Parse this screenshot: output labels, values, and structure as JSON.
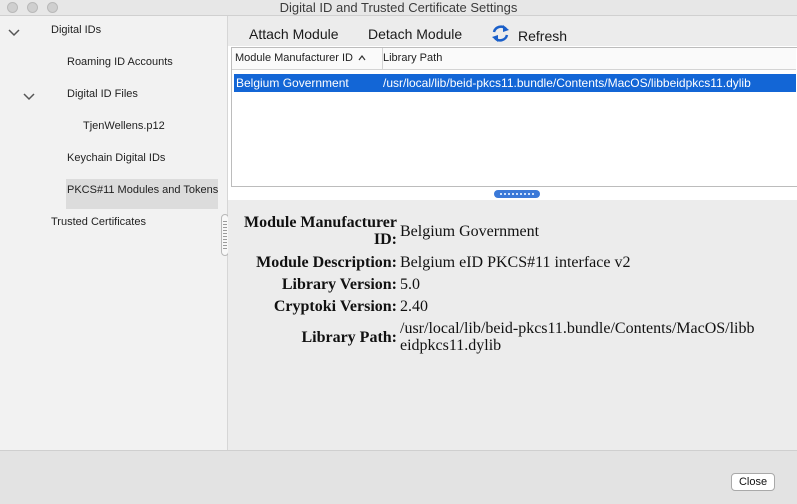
{
  "window": {
    "title": "Digital ID and Trusted Certificate Settings"
  },
  "sidebar": {
    "items": [
      {
        "label": "Digital IDs"
      },
      {
        "label": "Roaming ID Accounts"
      },
      {
        "label": "Digital ID Files"
      },
      {
        "label": "TjenWellens.p12"
      },
      {
        "label": "Keychain Digital IDs"
      },
      {
        "label": "PKCS#11 Modules and Tokens"
      },
      {
        "label": "Trusted Certificates"
      }
    ]
  },
  "toolbar": {
    "attach_label": "Attach Module",
    "detach_label": "Detach Module",
    "refresh_label": "Refresh"
  },
  "table": {
    "columns": [
      "Module Manufacturer ID",
      "Library Path"
    ],
    "rows": [
      {
        "manufacturer": "Belgium Government",
        "path": "/usr/local/lib/beid-pkcs11.bundle/Contents/MacOS/libbeidpkcs11.dylib"
      }
    ]
  },
  "details": {
    "manufacturer_label": "Module Manufacturer ID:",
    "manufacturer_value": "Belgium Government",
    "description_label": "Module Description:",
    "description_value": "Belgium eID PKCS#11 interface v2",
    "library_version_label": "Library Version:",
    "library_version_value": "5.0",
    "cryptoki_label": "Cryptoki Version:",
    "cryptoki_value": "2.40",
    "path_label": "Library Path:",
    "path_value": "/usr/local/lib/beid-pkcs11.bundle/Contents/MacOS/libbeidpkcs11.dylib"
  },
  "footer": {
    "close_label": "Close"
  }
}
